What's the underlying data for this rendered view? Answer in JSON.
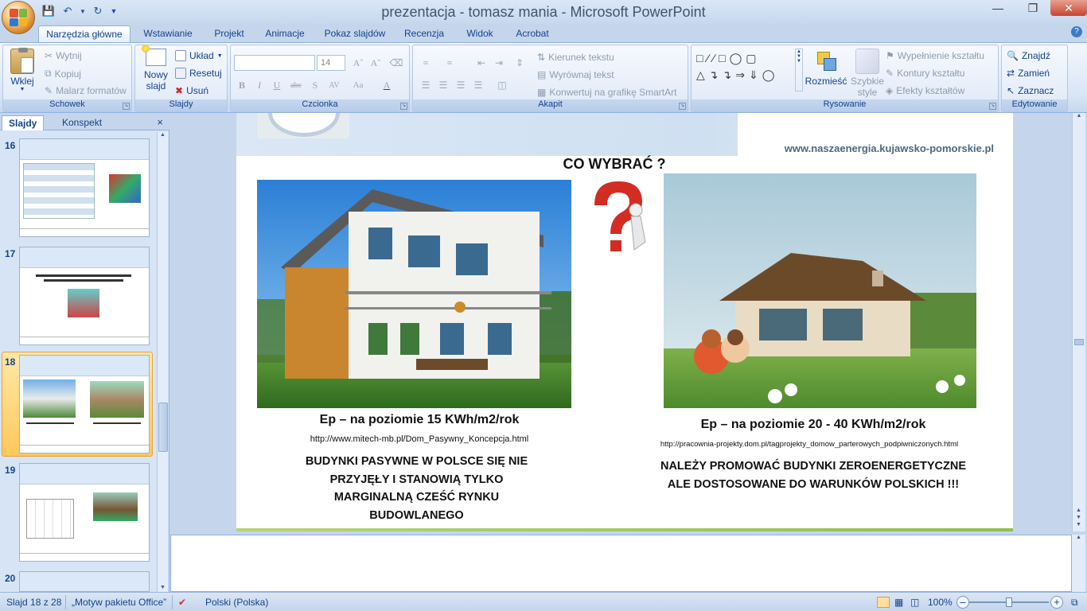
{
  "window": {
    "title": "prezentacja - tomasz mania - Microsoft PowerPoint"
  },
  "ribbon_tabs": [
    "Narzędzia główne",
    "Wstawianie",
    "Projekt",
    "Animacje",
    "Pokaz slajdów",
    "Recenzja",
    "Widok",
    "Acrobat"
  ],
  "ribbon": {
    "clipboard": {
      "label": "Schowek",
      "paste": "Wklej",
      "cut": "Wytnij",
      "copy": "Kopiuj",
      "format_painter": "Malarz formatów"
    },
    "slides": {
      "label": "Slajdy",
      "new_slide_line1": "Nowy",
      "new_slide_line2": "slajd",
      "layout": "Układ",
      "reset": "Resetuj",
      "delete": "Usuń"
    },
    "font": {
      "label": "Czcionka",
      "font_name": "",
      "font_size": "14"
    },
    "paragraph": {
      "label": "Akapit",
      "text_direction": "Kierunek tekstu",
      "align_text": "Wyrównaj tekst",
      "smartart": "Konwertuj na grafikę SmartArt"
    },
    "drawing": {
      "label": "Rysowanie",
      "arrange": "Rozmieść",
      "quick_styles_line1": "Szybkie",
      "quick_styles_line2": "style",
      "shape_fill": "Wypełnienie kształtu",
      "shape_outline": "Kontury kształtu",
      "shape_effects": "Efekty kształtów"
    },
    "editing": {
      "label": "Edytowanie",
      "find": "Znajdź",
      "replace": "Zamień",
      "select": "Zaznacz"
    }
  },
  "left_pane": {
    "tabs": [
      "Slajdy",
      "Konspekt"
    ],
    "slides": [
      {
        "num": "16",
        "selected": false
      },
      {
        "num": "17",
        "selected": false
      },
      {
        "num": "18",
        "selected": true
      },
      {
        "num": "19",
        "selected": false
      },
      {
        "num": "20",
        "selected": false
      }
    ]
  },
  "slide": {
    "banner_url": "www.naszaenergia.kujawsko-pomorskie.pl",
    "heading": "CO WYBRAĆ ?",
    "left": {
      "caption": "Ep – na  poziomie 15 KWh/m2/rok",
      "url": "http://www.mitech-mb.pl/Dom_Pasywny_Koncepcja.html",
      "body": "BUDYNKI PASYWNE W POLSCE SIĘ NIE PRZYJĘŁY I STANOWIĄ TYLKO MARGINALNĄ CZEŚĆ RYNKU BUDOWLANEGO"
    },
    "right": {
      "caption": "Ep – na poziomie 20 - 40 KWh/m2/rok",
      "url": "http://pracownia-projekty.dom.pl/tagprojekty_domow_parterowych_podpiwniczonych.html",
      "body_line1": "NALEŻY PROMOWAĆ BUDYNKI  ZEROENERGETYCZNE",
      "body_line2": "ALE  DOSTOSOWANE DO  WARUNKÓW POLSKICH !!!"
    }
  },
  "statusbar": {
    "slide_info": "Slajd 18 z 28",
    "theme": "„Motyw pakietu Office”",
    "language": "Polski (Polska)",
    "zoom": "100%"
  },
  "colors": {
    "accent": "#15428b",
    "ribbon_bg": "#dfe9f7",
    "selected_thumb": "#ffc85a"
  }
}
